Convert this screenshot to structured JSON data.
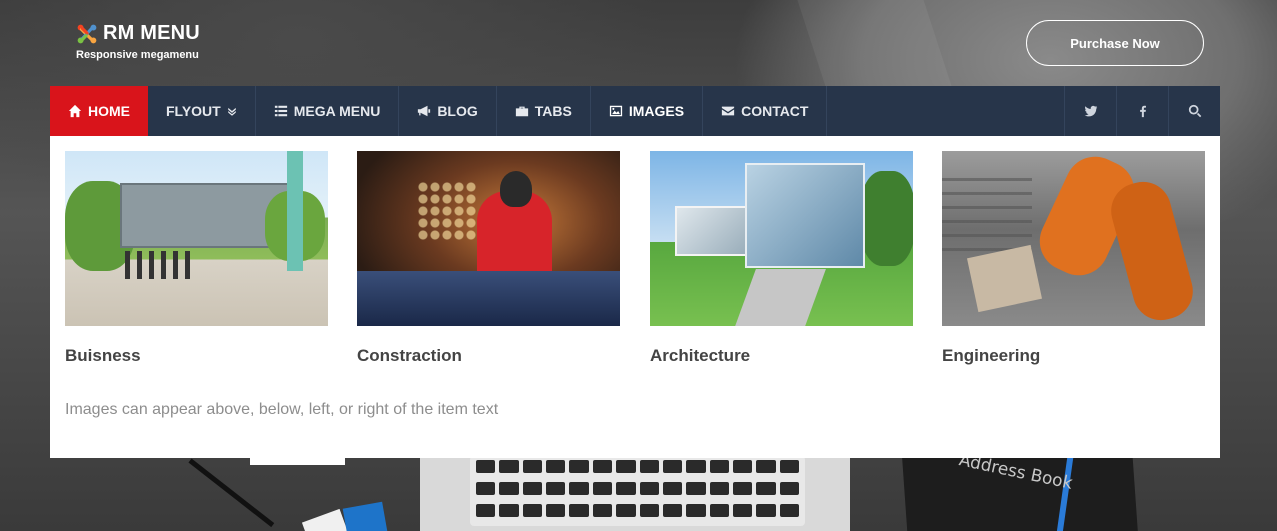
{
  "brand": {
    "title": "RM MENU",
    "subtitle": "Responsive megamenu",
    "logo_icon": "joomla-logo-icon"
  },
  "header": {
    "purchase_label": "Purchase Now"
  },
  "nav": {
    "items": [
      {
        "label": "HOME",
        "icon": "home-icon",
        "active": true
      },
      {
        "label": "FLYOUT",
        "icon": "chevron-double-down-icon"
      },
      {
        "label": "MEGA MENU",
        "icon": "list-icon"
      },
      {
        "label": "BLOG",
        "icon": "bullhorn-icon"
      },
      {
        "label": "TABS",
        "icon": "briefcase-icon"
      },
      {
        "label": "IMAGES",
        "icon": "image-icon",
        "current": true
      },
      {
        "label": "CONTACT",
        "icon": "envelope-icon"
      }
    ],
    "right_icons": [
      "twitter-icon",
      "facebook-icon",
      "search-icon"
    ],
    "colors": {
      "bar": "#27354a",
      "active": "#d9141b"
    }
  },
  "mega": {
    "cards": [
      {
        "label": "Buisness"
      },
      {
        "label": "Constraction"
      },
      {
        "label": "Architecture"
      },
      {
        "label": "Engineering"
      }
    ],
    "note": "Images can appear above, below, left, or right of the item text"
  },
  "background": {
    "notebook_text": "Address Book"
  }
}
